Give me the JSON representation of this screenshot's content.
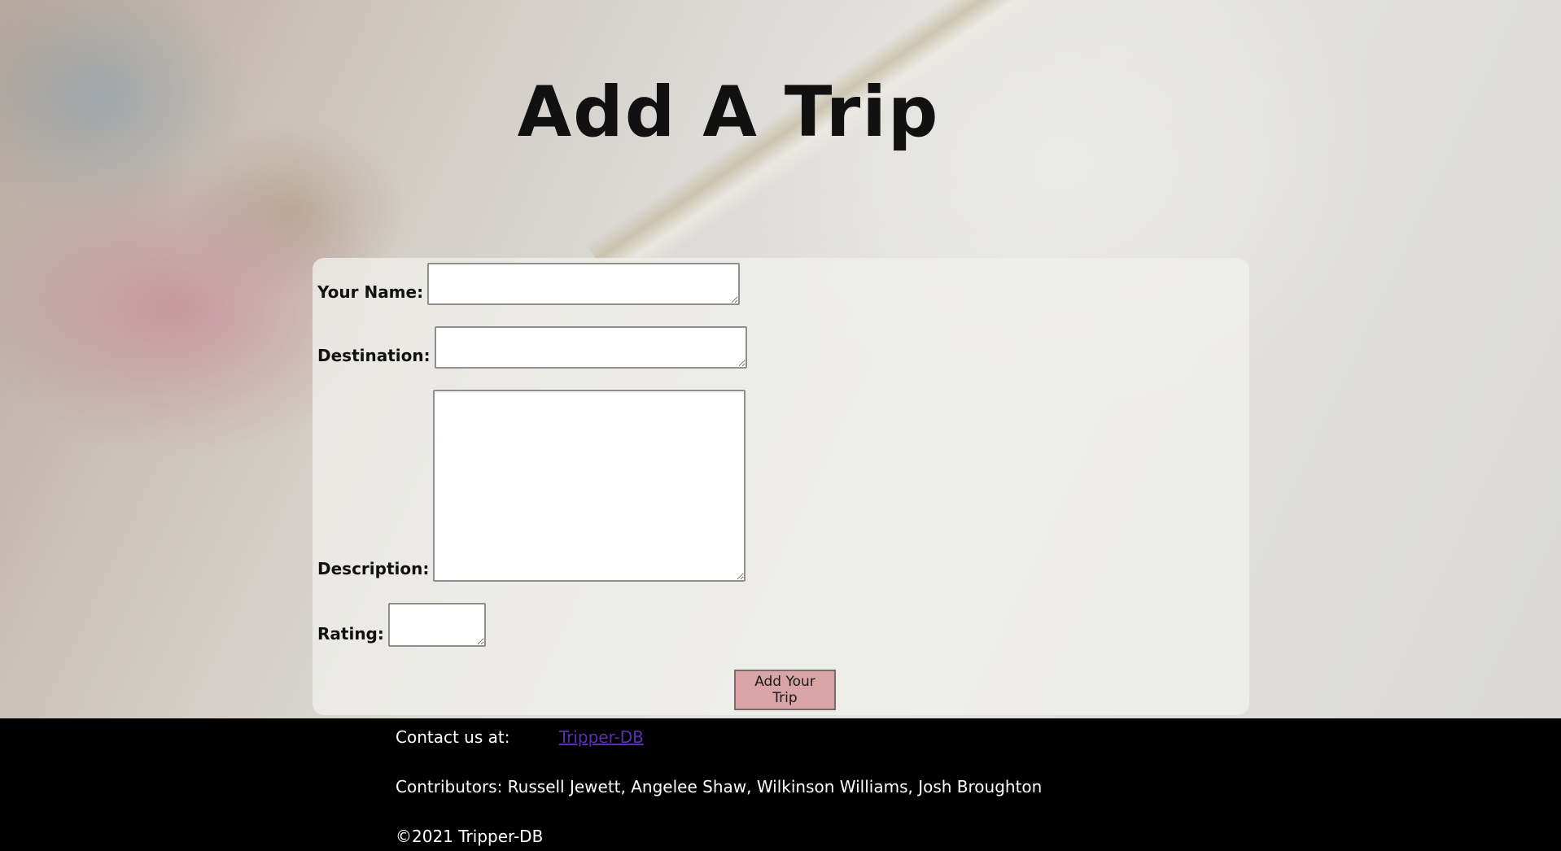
{
  "page": {
    "title": "Add A Trip"
  },
  "form": {
    "name_label": "Your Name:",
    "destination_label": "Destination:",
    "description_label": "Description:",
    "rating_label": "Rating:",
    "name_value": "",
    "destination_value": "",
    "description_value": "",
    "rating_value": "",
    "submit_label": "Add Your Trip"
  },
  "footer": {
    "contact_label": "Contact us at:",
    "contact_link": "Tripper-DB",
    "contributors": "Contributors: Russell Jewett, Angelee Shaw, Wilkinson Williams, Josh Broughton",
    "copyright": "©2021 Tripper-DB"
  },
  "colors": {
    "button_bg": "#d8a4a6",
    "link": "#5b2fb0",
    "footer_bg": "#000000"
  }
}
